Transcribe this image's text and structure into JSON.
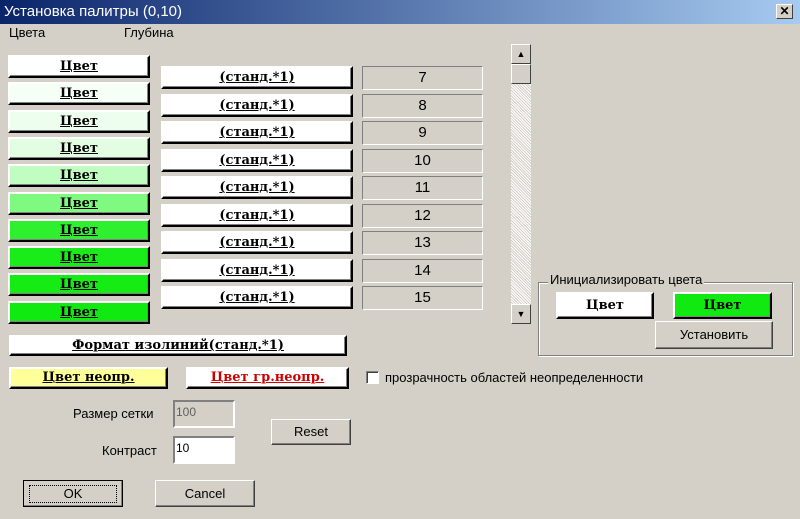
{
  "window": {
    "title": "Установка палитры (0,10)",
    "close_glyph": "✕"
  },
  "tabs": {
    "colors": "Цвета",
    "depth": "Глубина"
  },
  "color_buttons": [
    {
      "label": "Цвет",
      "bg": "#ffffff"
    },
    {
      "label": "Цвет",
      "bg": "#f6fff6"
    },
    {
      "label": "Цвет",
      "bg": "#eefeee"
    },
    {
      "label": "Цвет",
      "bg": "#e2fde2"
    },
    {
      "label": "Цвет",
      "bg": "#c1fcc1"
    },
    {
      "label": "Цвет",
      "bg": "#80f980"
    },
    {
      "label": "Цвет",
      "bg": "#2ef02e"
    },
    {
      "label": "Цвет",
      "bg": "#1aec1a"
    },
    {
      "label": "Цвет",
      "bg": "#14ec14"
    },
    {
      "label": "Цвет",
      "bg": "#10ea10"
    }
  ],
  "format_buttons": [
    "(станд.*1)",
    "(станд.*1)",
    "(станд.*1)",
    "(станд.*1)",
    "(станд.*1)",
    "(станд.*1)",
    "(станд.*1)",
    "(станд.*1)",
    "(станд.*1)"
  ],
  "depth_values": [
    "7",
    "8",
    "9",
    "10",
    "11",
    "12",
    "13",
    "14",
    "15"
  ],
  "scrollbar": {
    "up_icon": "▲",
    "down_icon": "▼"
  },
  "contour_format": "Формат изолиний(станд.*1)",
  "undefined_color": {
    "label": "Цвет неопр.",
    "bg": "#ffff99"
  },
  "boundary_color": {
    "label": "Цвет гр.неопр.",
    "text_color": "#cc0000"
  },
  "transparency_label": "прозрачность областей неопределенности",
  "init_group": {
    "title": "Инициализировать цвета",
    "color1": {
      "label": "Цвет",
      "bg": "#ffffff"
    },
    "color2": {
      "label": "Цвет",
      "bg": "#10ea10"
    },
    "set_button": "Установить"
  },
  "grid_size": {
    "label": "Размер сетки",
    "value": "100"
  },
  "contrast": {
    "label": "Контраст",
    "value": "10"
  },
  "reset_button": "Reset",
  "ok_button": "OK",
  "cancel_button": "Cancel"
}
